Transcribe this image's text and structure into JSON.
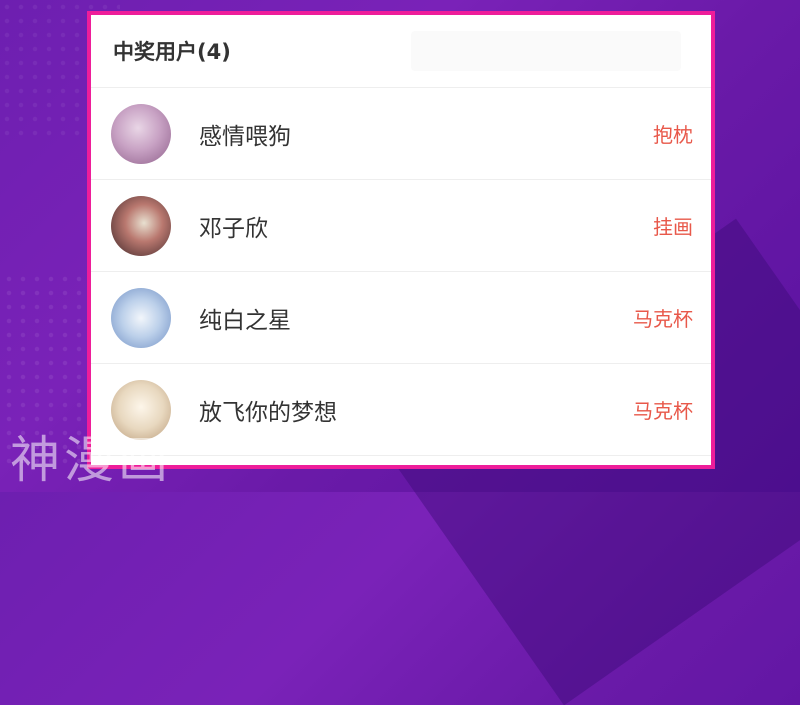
{
  "panel": {
    "title": "中奖用户(4)"
  },
  "winners": [
    {
      "username": "感情喂狗",
      "prize": "抱枕"
    },
    {
      "username": "邓子欣",
      "prize": "挂画"
    },
    {
      "username": "纯白之星",
      "prize": "马克杯"
    },
    {
      "username": "放飞你的梦想",
      "prize": "马克杯"
    }
  ],
  "watermark": "神漫画",
  "colors": {
    "panel_border": "#ee1d9a",
    "prize_text": "#e8584a",
    "background": "#6d1fb0"
  }
}
